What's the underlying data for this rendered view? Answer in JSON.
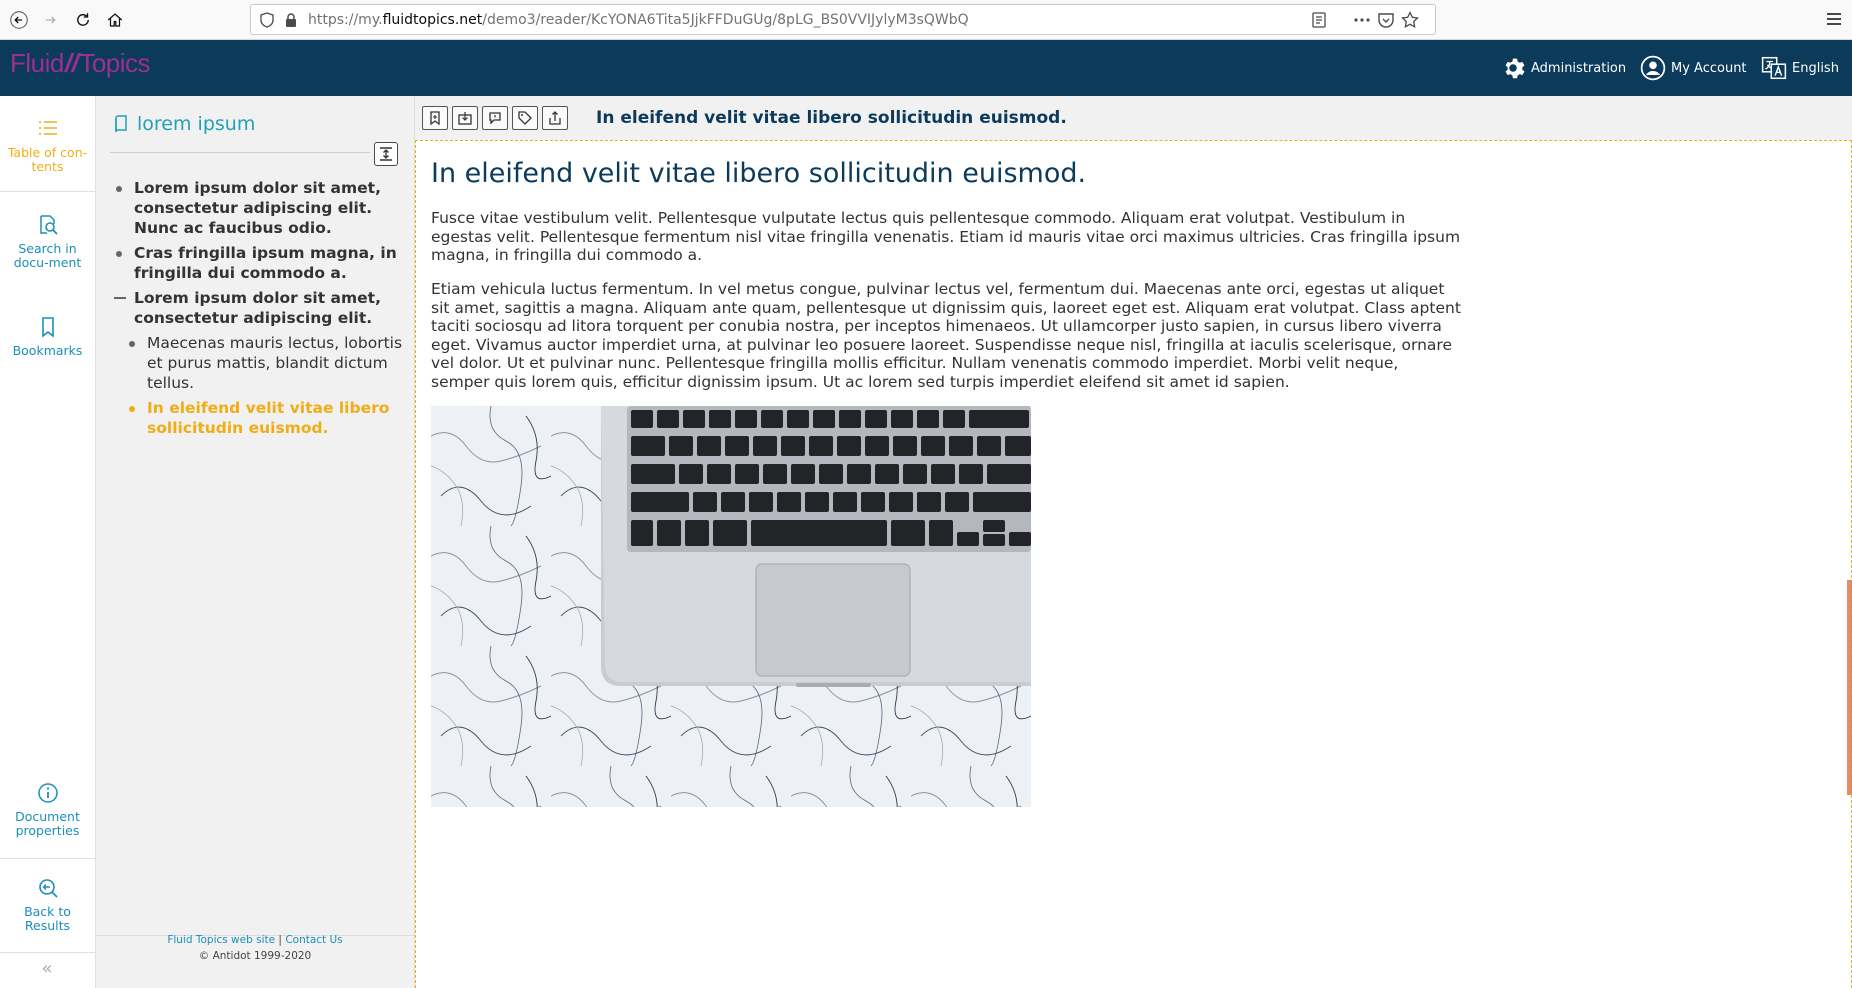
{
  "browser": {
    "url_prefix": "https://my.",
    "url_domain": "fluidtopics.net",
    "url_path": "/demo3/reader/KcYONA6Tita5JjkFFDuGUg/8pLG_BS0VVIJylyM3sQWbQ"
  },
  "header": {
    "logo_left": "Fluid",
    "logo_slash": "//",
    "logo_right": "Topics",
    "administration_label": "Administration",
    "account_label": "My Account",
    "language_label": "English"
  },
  "rail": {
    "toc_label": "Table of con-tents",
    "search_label": "Search in docu-ment",
    "bookmarks_label": "Bookmarks",
    "properties_label": "Document properties",
    "back_label": "Back to Results"
  },
  "toc": {
    "title": "lorem ipsum",
    "entries": [
      {
        "text": "Lorem ipsum dolor sit amet, consectetur adipiscing elit. Nunc ac faucibus odio."
      },
      {
        "text": "Cras fringilla ipsum magna, in fringilla dui commodo a."
      },
      {
        "text": "Lorem ipsum dolor sit amet, consectetur adipiscing elit."
      },
      {
        "text": "Maecenas mauris lectus, lobortis et purus mattis, blandit dictum tellus."
      },
      {
        "text": "In eleifend velit vitae libero sollicitudin euismod."
      }
    ],
    "footer_site": "Fluid Topics web site",
    "footer_sep": "|",
    "footer_contact": "Contact Us",
    "footer_copyright": "© Antidot 1999-2020"
  },
  "toolbar": {
    "title": "In eleifend velit vitae libero sollicitudin euismod."
  },
  "content": {
    "heading": "In eleifend velit vitae libero sollicitudin euismod.",
    "paragraph_1": "Fusce vitae vestibulum velit. Pellentesque vulputate lectus quis pellentesque commodo. Aliquam erat volutpat. Vestibulum in egestas velit. Pellentesque fermentum nisl vitae fringilla venenatis. Etiam id mauris vitae orci maximus ultricies. Cras fringilla ipsum magna, in fringilla dui commodo a.",
    "paragraph_2": "Etiam vehicula luctus fermentum. In vel metus congue, pulvinar lectus vel, fermentum dui. Maecenas ante orci, egestas ut aliquet sit amet, sagittis a magna. Aliquam ante quam, pellentesque ut dignissim quis, laoreet eget est. Aliquam erat volutpat. Class aptent taciti sociosqu ad litora torquent per conubia nostra, per inceptos himenaeos. Ut ullamcorper justo sapien, in cursus libero viverra eget. Vivamus auctor imperdiet urna, at pulvinar leo posuere laoreet. Suspendisse neque nisl, fringilla at iaculis scelerisque, ornare vel dolor. Ut et pulvinar nunc. Pellentesque fringilla mollis efficitur. Nullam venenatis commodo imperdiet. Morbi velit neque, semper quis lorem quis, efficitur dignissim ipsum. Ut ac lorem sed turpis imperdiet eleifend sit amet id sapien."
  },
  "colors": {
    "header_bg": "#0b3a5b",
    "brand": "#9c2f8f",
    "accent": "#f0ad16",
    "link": "#1b8fb8"
  }
}
